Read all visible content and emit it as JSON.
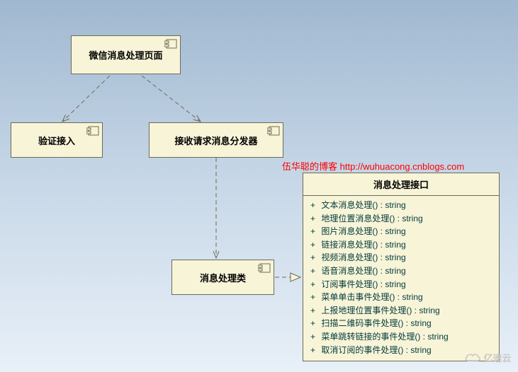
{
  "watermark": "伍华聪的博客 http://wuhuacong.cnblogs.com",
  "logo_text": "亿速云",
  "components": {
    "page": {
      "label": "微信消息处理页面"
    },
    "verify": {
      "label": "验证接入"
    },
    "dispatcher": {
      "label": "接收请求消息分发器"
    },
    "handler": {
      "label": "消息处理类"
    }
  },
  "interface": {
    "title": "消息处理接口",
    "operations": [
      {
        "vis": "+",
        "sig": "文本消息处理() : string"
      },
      {
        "vis": "+",
        "sig": "地理位置消息处理() : string"
      },
      {
        "vis": "+",
        "sig": "图片消息处理() : string"
      },
      {
        "vis": "+",
        "sig": "链接消息处理() : string"
      },
      {
        "vis": "+",
        "sig": "视频消息处理() : string"
      },
      {
        "vis": "+",
        "sig": "语音消息处理() : string"
      },
      {
        "vis": "+",
        "sig": "订阅事件处理() : string"
      },
      {
        "vis": "+",
        "sig": "菜单单击事件处理() : string"
      },
      {
        "vis": "+",
        "sig": "上报地理位置事件处理() : string"
      },
      {
        "vis": "+",
        "sig": "扫描二维码事件处理() : string"
      },
      {
        "vis": "+",
        "sig": "菜单跳转链接的事件处理() : string"
      },
      {
        "vis": "+",
        "sig": "取消订阅的事件处理() : string"
      }
    ]
  },
  "chart_data": {
    "type": "diagram",
    "nodes": [
      {
        "id": "page",
        "kind": "component",
        "label": "微信消息处理页面"
      },
      {
        "id": "verify",
        "kind": "component",
        "label": "验证接入"
      },
      {
        "id": "dispatcher",
        "kind": "component",
        "label": "接收请求消息分发器"
      },
      {
        "id": "handler",
        "kind": "component",
        "label": "消息处理类"
      },
      {
        "id": "iface",
        "kind": "interface",
        "label": "消息处理接口",
        "operations": [
          "文本消息处理() : string",
          "地理位置消息处理() : string",
          "图片消息处理() : string",
          "链接消息处理() : string",
          "视频消息处理() : string",
          "语音消息处理() : string",
          "订阅事件处理() : string",
          "菜单单击事件处理() : string",
          "上报地理位置事件处理() : string",
          "扫描二维码事件处理() : string",
          "菜单跳转链接的事件处理() : string",
          "取消订阅的事件处理() : string"
        ]
      }
    ],
    "edges": [
      {
        "from": "page",
        "to": "verify",
        "type": "dependency"
      },
      {
        "from": "page",
        "to": "dispatcher",
        "type": "dependency"
      },
      {
        "from": "dispatcher",
        "to": "handler",
        "type": "dependency"
      },
      {
        "from": "handler",
        "to": "iface",
        "type": "realization"
      }
    ]
  }
}
